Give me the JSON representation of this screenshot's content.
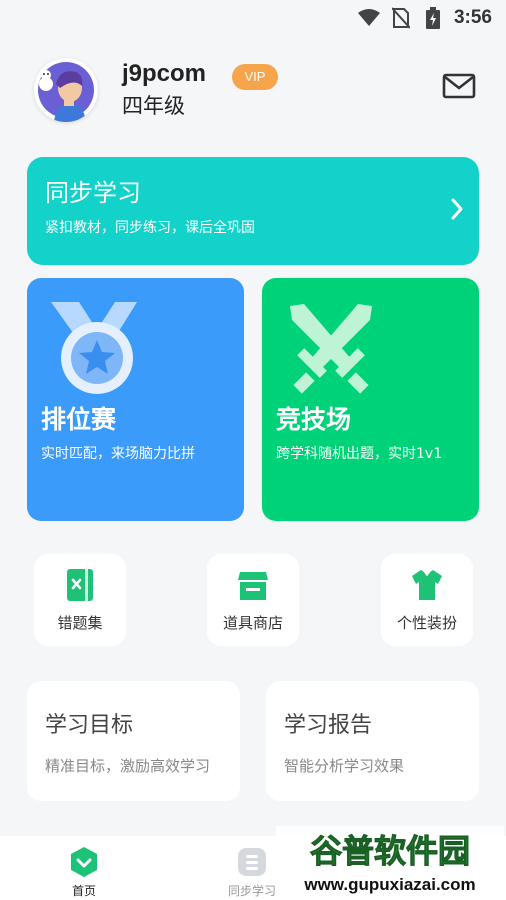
{
  "status_bar": {
    "time": "3:56"
  },
  "profile": {
    "username": "j9pcom",
    "vip_label": "VIP",
    "grade": "四年级"
  },
  "sync_study": {
    "title": "同步学习",
    "subtitle": "紧扣教材，同步练习，课后全巩固"
  },
  "ranked": {
    "title": "排位赛",
    "subtitle": "实时匹配，来场脑力比拼"
  },
  "arena": {
    "title": "竞技场",
    "subtitle": "跨学科随机出题，实时1v1"
  },
  "shortcuts": [
    {
      "label": "错题集",
      "icon": "notebook-icon"
    },
    {
      "label": "道具商店",
      "icon": "store-icon"
    },
    {
      "label": "个性装扮",
      "icon": "tshirt-icon"
    }
  ],
  "cards": [
    {
      "title": "学习目标",
      "subtitle": "精准目标，激励高效学习"
    },
    {
      "title": "学习报告",
      "subtitle": "智能分析学习效果"
    }
  ],
  "bottom_nav": [
    {
      "label": "首页",
      "active": true
    },
    {
      "label": "同步学习",
      "active": false
    }
  ],
  "watermark": {
    "title": "谷普软件园",
    "url": "www.gupuxiazai.com"
  },
  "colors": {
    "sync_card": "#13d2ca",
    "ranked_tile": "#3a9bfa",
    "arena_tile": "#00d27a",
    "vip_badge": "#f7a54a",
    "nav_active": "#1ec276"
  }
}
